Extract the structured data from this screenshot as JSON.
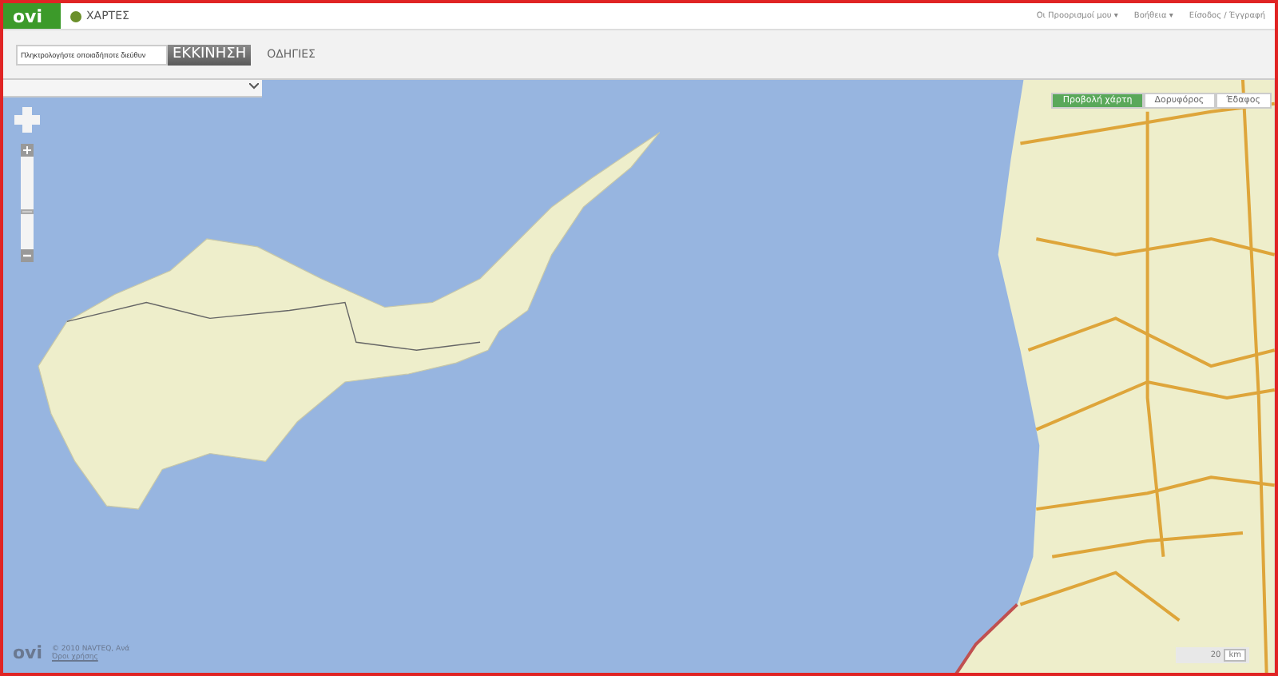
{
  "header": {
    "logo": "ovi",
    "app_name": "ΧΑΡΤΕΣ",
    "links": [
      "Οι Προορισμοί μου ▾",
      "Βοήθεια ▾",
      "Είσοδος / Έγγραφή"
    ]
  },
  "toolbar": {
    "search": {
      "placeholder": "Πληκτρολογήστε οποιαδήποτε διεύθυν"
    },
    "start_button": "ΕΚΚΙΝΗΣΗ",
    "directions_link": "ΟΔΗΓΙΕΣ"
  },
  "map": {
    "view_tabs": [
      {
        "label": "Προβολή χάρτη",
        "selected": true
      },
      {
        "label": "Δορυφόρος",
        "selected": false
      },
      {
        "label": "Έδαφος",
        "selected": false
      }
    ],
    "zoom": {
      "level": 0.4
    },
    "scale": {
      "value": "20",
      "unit": "km"
    }
  },
  "footer": {
    "logo": "ovi",
    "copyright": "© 2010 NAVTEQ, Ανά",
    "terms_link": "Όροι χρήσης"
  }
}
